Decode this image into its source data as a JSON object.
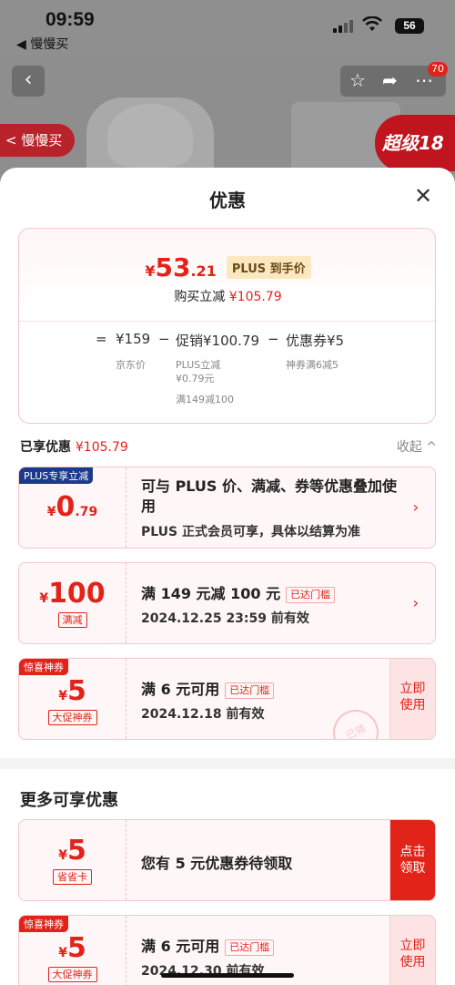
{
  "status_bar": {
    "time": "09:59",
    "back_app": "◀ 慢慢买",
    "battery": "56"
  },
  "product_header": {
    "manman_tag": "< 慢慢买",
    "super_tag": "超级18",
    "notify_count": "70"
  },
  "sheet": {
    "title": "优惠",
    "summary": {
      "price_yen": "¥",
      "price_int": "53",
      "price_dec": ".21",
      "plus_tag": "PLUS 到手价",
      "buy_text": "购买立减",
      "buy_amount": "¥105.79",
      "formula": {
        "eq": "=",
        "jd_price": "¥159",
        "jd_label": "京东价",
        "minus1": "−",
        "promo": "促销¥100.79",
        "promo_sub1": "PLUS立减",
        "promo_sub2": "¥0.79元",
        "promo_sub3": "满149减100",
        "minus2": "−",
        "coupon": "优惠券¥5",
        "coupon_sub": "神券满6减5"
      }
    },
    "enjoyed": {
      "label": "已享优惠",
      "amount": "¥105.79",
      "collapse": "收起 ^"
    },
    "cards": [
      {
        "corner": "PLUS专享立减",
        "yen": "¥",
        "big": "0",
        "small": ".79",
        "title": "可与 PLUS 价、满减、券等优惠叠加使用",
        "sub": "PLUS 正式会员可享，具体以结算为准"
      },
      {
        "yen": "¥",
        "big": "100",
        "badge": "满减",
        "title": "满 149 元减 100 元",
        "status": "已达门槛",
        "sub": "2024.12.25 23:59 前有效"
      },
      {
        "corner": "惊喜神券",
        "yen": "¥",
        "big": "5",
        "badge": "大促神券",
        "title": "满 6 元可用",
        "status": "已达门槛",
        "sub": "2024.12.18 前有效",
        "action": "立即使用",
        "stamp": "已领"
      }
    ],
    "more": {
      "title": "更多可享优惠",
      "cards": [
        {
          "yen": "¥",
          "big": "5",
          "badge": "省省卡",
          "title": "您有 5 元优惠券待领取",
          "action": "点击领取"
        },
        {
          "corner": "惊喜神券",
          "yen": "¥",
          "big": "5",
          "badge": "大促神券",
          "title": "满 6 元可用",
          "status": "已达门槛",
          "sub": "2024.12.30 前有效",
          "action": "立即使用"
        }
      ]
    }
  },
  "colors": {
    "accent": "#e2231a",
    "plus_blue": "#1b3a8c",
    "card_bg": "#fff7f7"
  }
}
